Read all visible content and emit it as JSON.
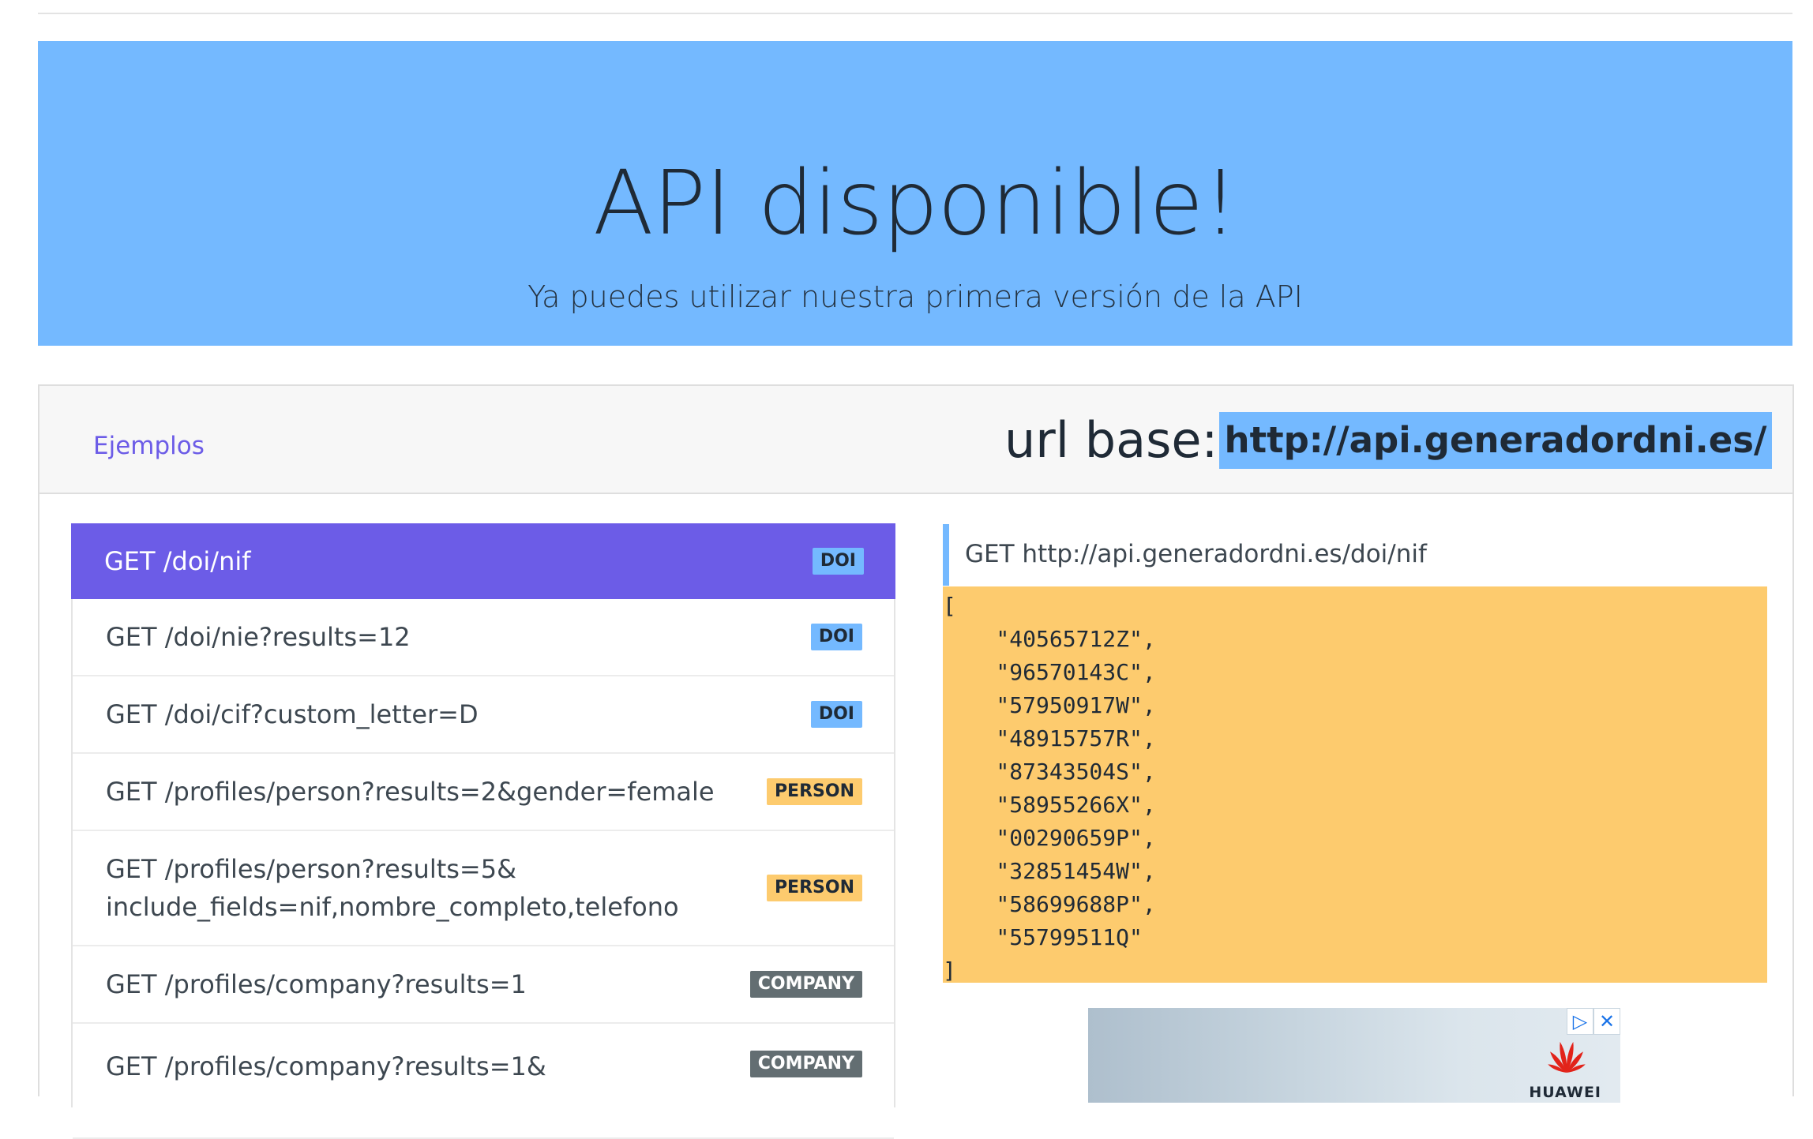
{
  "hero": {
    "title": "API disponible!",
    "subtitle": "Ya puedes utilizar nuestra primera versión de la API"
  },
  "header": {
    "examples_link": "Ejemplos",
    "url_base_label": "url base:",
    "url_base_value": "http://api.generadordni.es/"
  },
  "endpoints": [
    {
      "label": "GET /doi/nif",
      "tag": "DOI",
      "active": true
    },
    {
      "label": "GET /doi/nie?results=12",
      "tag": "DOI"
    },
    {
      "label": "GET /doi/cif?custom_letter=D",
      "tag": "DOI"
    },
    {
      "label": "GET /profiles/person?results=2&gender=female",
      "tag": "PERSON"
    },
    {
      "label": "GET /profiles/person?results=5& include_fields=nif,nombre_completo,telefono",
      "tag": "PERSON"
    },
    {
      "label": "GET /profiles/company?results=1",
      "tag": "COMPANY"
    },
    {
      "label": "GET /profiles/company?results=1&",
      "tag": "COMPANY"
    }
  ],
  "request": {
    "line": "GET http://api.generadordni.es/doi/nif"
  },
  "response": {
    "lines": [
      "[",
      "    \"40565712Z\",",
      "    \"96570143C\",",
      "    \"57950917W\",",
      "    \"48915757R\",",
      "    \"87343504S\",",
      "    \"58955266X\",",
      "    \"00290659P\",",
      "    \"32851454W\",",
      "    \"58699688P\",",
      "    \"55799511Q\"",
      "]"
    ]
  },
  "ad": {
    "brand": "HUAWEI",
    "choices_icon": "adchoices-icon",
    "close_icon": "close-icon"
  },
  "colors": {
    "hero_bg": "#74b9ff",
    "active_item": "#6c5ce7",
    "response_bg": "#fdcb6e",
    "company_tag": "#636e72"
  }
}
